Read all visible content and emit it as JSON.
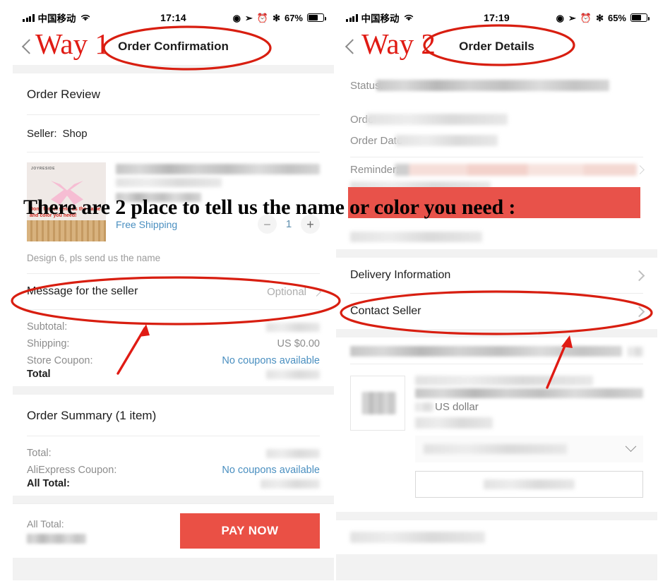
{
  "annotations": {
    "way1_label": "Way 1",
    "way2_label": "Way 2",
    "overlay_text": "There are 2 place to tell us the name or color you need :",
    "accent_red": "#e01b14",
    "band_red": "#e8524a"
  },
  "left_phone": {
    "status_bar": {
      "carrier": "中国移动",
      "time": "17:14",
      "battery_percent": "67%",
      "icons": [
        "signal-bars-icon",
        "wifi-icon",
        "rotation-lock-icon",
        "location-arrow-icon",
        "alarm-clock-icon",
        "bluetooth-icon",
        "battery-icon"
      ]
    },
    "nav": {
      "title": "Order Confirmation",
      "back": "back-chevron-icon"
    },
    "order_review": {
      "section_title": "Order Review",
      "seller_label": "Seller:",
      "seller_name": "Shop",
      "product": {
        "thumb_brand": "JOYRESIDE",
        "thumb_red_text": "Don't forget send us the name and color you need!",
        "shipping_label": "Free Shipping",
        "quantity": "1",
        "minus": "−",
        "plus": "+",
        "note": "Design 6, pls send us the name"
      },
      "message_row": {
        "label": "Message for the seller",
        "value": "Optional"
      },
      "totals": [
        {
          "label": "Subtotal:",
          "value": "",
          "type": "blur"
        },
        {
          "label": "Shipping:",
          "value": "US $0.00",
          "type": "text"
        },
        {
          "label": "Store Coupon:",
          "value": "No coupons available",
          "type": "link"
        },
        {
          "label": "Total",
          "value": "",
          "type": "blur",
          "bold": true
        }
      ]
    },
    "order_summary": {
      "section_title": "Order Summary (1 item)",
      "rows": [
        {
          "label": "Total:",
          "value": "",
          "type": "blur"
        },
        {
          "label": "AliExpress Coupon:",
          "value": "No coupons available",
          "type": "link"
        },
        {
          "label": "All Total:",
          "value": "",
          "type": "blur",
          "bold": true
        }
      ]
    },
    "pay_bar": {
      "all_total_label": "All Total:",
      "pay_button": "PAY NOW"
    }
  },
  "right_phone": {
    "status_bar": {
      "carrier": "中国移动",
      "time": "17:19",
      "battery_percent": "65%",
      "icons": [
        "signal-bars-icon",
        "wifi-icon",
        "rotation-lock-icon",
        "location-arrow-icon",
        "alarm-clock-icon",
        "bluetooth-icon",
        "battery-icon"
      ]
    },
    "nav": {
      "title": "Order Details",
      "back": "back-chevron-icon"
    },
    "order_info": {
      "status_label": "Status:",
      "order_label": "Orde",
      "order_date_label": "Order Date",
      "reminder_label": "Reminder:"
    },
    "links": [
      {
        "label": "Delivery Information"
      },
      {
        "label": "Contact Seller"
      }
    ],
    "product": {
      "currency_note": "US dollar"
    }
  }
}
